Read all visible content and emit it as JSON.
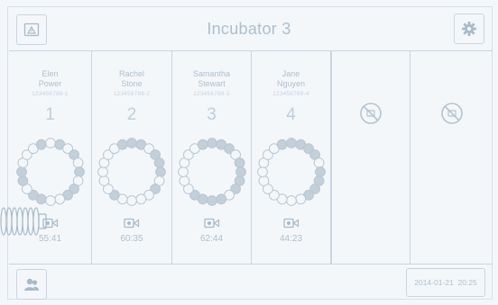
{
  "header": {
    "title": "Incubator 3",
    "alarm_icon": "warning-monitor-icon",
    "settings_icon": "gear-icon"
  },
  "bays": [
    {
      "first": "Elen",
      "last": "Power",
      "id": "123456789-1",
      "number": "1",
      "time": "55:41"
    },
    {
      "first": "Rachel",
      "last": "Stone",
      "id": "123456789-2",
      "number": "2",
      "time": "60:35"
    },
    {
      "first": "Samantha",
      "last": "Stewart",
      "id": "123456789-3",
      "number": "3",
      "time": "62:44"
    },
    {
      "first": "Jane",
      "last": "Nguyen",
      "id": "123456789-4",
      "number": "4",
      "time": "44:23"
    }
  ],
  "empty_slots": [
    {
      "icon": "unavailable-icon"
    },
    {
      "icon": "unavailable-icon"
    }
  ],
  "footer": {
    "user_icon": "users-icon",
    "date": "2014-01-21",
    "time": "20:25"
  },
  "colors": {
    "background": "#f4f7fa",
    "border": "#c9d5df",
    "text": "#aebfcc"
  }
}
